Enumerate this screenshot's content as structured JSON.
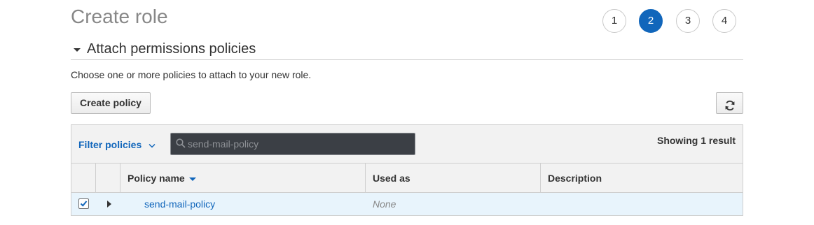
{
  "page": {
    "title": "Create role"
  },
  "steps": [
    {
      "label": "1",
      "active": false
    },
    {
      "label": "2",
      "active": true
    },
    {
      "label": "3",
      "active": false
    },
    {
      "label": "4",
      "active": false
    }
  ],
  "section": {
    "title": "Attach permissions policies",
    "description": "Choose one or more policies to attach to your new role."
  },
  "toolbar": {
    "create_policy_label": "Create policy",
    "refresh_icon": "refresh-icon"
  },
  "filter": {
    "dropdown_label": "Filter policies",
    "search_value": "send-mail-policy",
    "result_count": "Showing 1 result"
  },
  "table": {
    "columns": [
      "Policy name",
      "Used as",
      "Description"
    ],
    "rows": [
      {
        "selected": true,
        "policy_name": "send-mail-policy",
        "used_as": "None",
        "description": ""
      }
    ]
  },
  "colors": {
    "accent": "#1166bb",
    "selected_row_bg": "#e8f4fc",
    "search_bg": "#3b3f45"
  }
}
